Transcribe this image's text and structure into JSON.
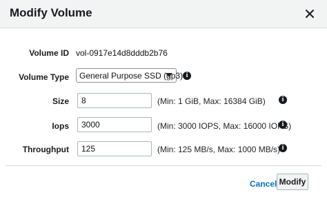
{
  "dialog": {
    "title": "Modify Volume",
    "close_icon": "close-icon"
  },
  "form": {
    "volume_id": {
      "label": "Volume ID",
      "value": "vol-0917e14d8dddb2b76"
    },
    "volume_type": {
      "label": "Volume Type",
      "value": "General Purpose SSD (gp3)",
      "info_icon": "info-icon"
    },
    "size": {
      "label": "Size",
      "value": "8",
      "hint": "(Min: 1 GiB, Max: 16384 GiB)",
      "info_icon": "info-icon"
    },
    "iops": {
      "label": "Iops",
      "value": "3000",
      "hint": "(Min: 3000 IOPS, Max: 16000 IOPS)",
      "info_icon": "info-icon"
    },
    "throughput": {
      "label": "Throughput",
      "value": "125",
      "hint": "(Min: 125 MB/s, Max: 1000 MB/s)",
      "info_icon": "info-icon"
    }
  },
  "footer": {
    "cancel_label": "Cancel",
    "modify_label": "Modify"
  },
  "colors": {
    "header_bg": "#f2f3f3",
    "link": "#0073bb",
    "text": "#16191f"
  }
}
